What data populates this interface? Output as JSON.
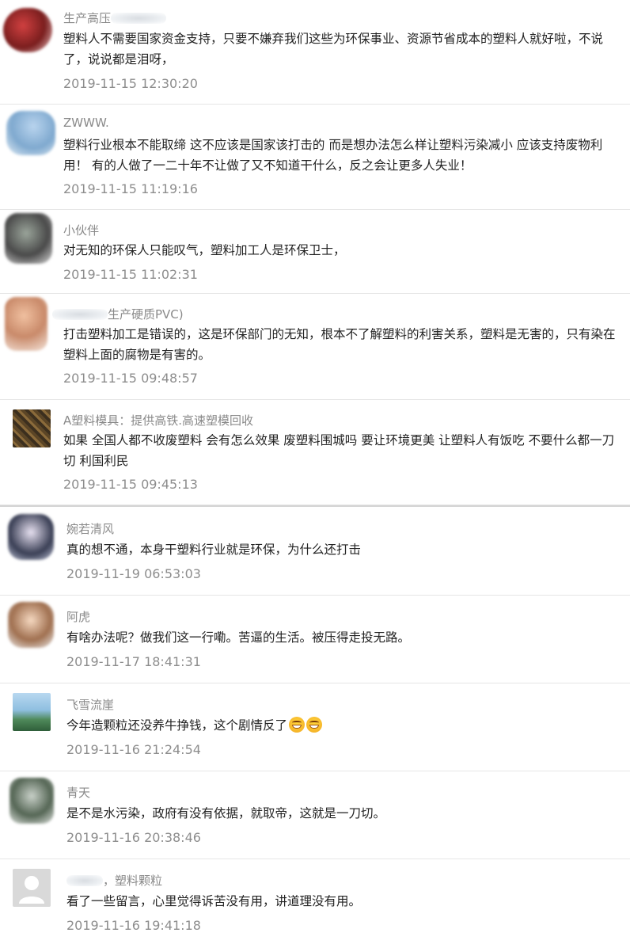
{
  "comments": [
    {
      "name_visible": "生产高压",
      "text": "塑料人不需要国家资金支持，只要不嫌弃我们这些为环保事业、资源节省成本的塑料人就好啦，不说了，说说都是泪呀，",
      "time": "2019-11-15 12:30:20",
      "avatar_color": "#8b2a2a"
    },
    {
      "name_visible": "ZWWW.",
      "text": "塑料行业根本不能取缔 这不应该是国家该打击的 而是想办法怎么样让塑料污染减小 应该支持废物利用！ 有的人做了一二十年不让做了又不知道干什么，反之会让更多人失业！",
      "time": "2019-11-15 11:19:16",
      "avatar_color": "#7fa9cf"
    },
    {
      "name_visible": "小伙伴",
      "text": "对无知的环保人只能叹气，塑料加工人是环保卫士，",
      "time": "2019-11-15 11:02:31",
      "avatar_color": "#4a4a4a"
    },
    {
      "name_visible": "生产硬质PVC)",
      "text": "打击塑料加工是错误的，这是环保部门的无知，根本不了解塑料的利害关系，塑料是无害的，只有染在塑料上面的腐物是有害的。",
      "time": "2019-11-15 09:48:57",
      "avatar_color": "#c98a6a"
    },
    {
      "name_visible": "A塑料模具：提供高铁.高速塑模回收",
      "text": "如果 全国人都不收废塑料 会有怎么效果 废塑料围城吗 要让环境更美 让塑料人有饭吃 不要什么都一刀切 利国利民",
      "time": "2019-11-15 09:45:13",
      "avatar_color": "#6b5230"
    },
    {
      "name_visible": "婉若清风",
      "text": "真的想不通，本身干塑料行业就是环保，为什么还打击",
      "time": "2019-11-19 06:53:03",
      "avatar_color": "#3a3f55"
    },
    {
      "name_visible": "阿虎",
      "text": "有啥办法呢？做我们这一行嘞。苦逼的生活。被压得走投无路。",
      "time": "2019-11-17 18:41:31",
      "avatar_color": "#a07050"
    },
    {
      "name_visible": "飞雪流崖",
      "text": "今年造颗粒还没养牛挣钱，这个剧情反了",
      "time": "2019-11-16 21:24:54",
      "avatar_color": "#5d8fb5",
      "emoji_count": 2,
      "emoji_icon": "grinning-face-icon"
    },
    {
      "name_visible": "青天",
      "text": "是不是水污染，政府有没有依据，就取帝，这就是一刀切。",
      "time": "2019-11-16 20:38:46",
      "avatar_color": "#556655"
    },
    {
      "name_visible": "，塑料颗粒",
      "text": "看了一些留言，心里觉得诉苦没有用，讲道理没有用。",
      "time": "2019-11-16 19:41:18",
      "avatar_color": "#d9d9d9",
      "avatar_icon": "default-user-icon"
    }
  ]
}
